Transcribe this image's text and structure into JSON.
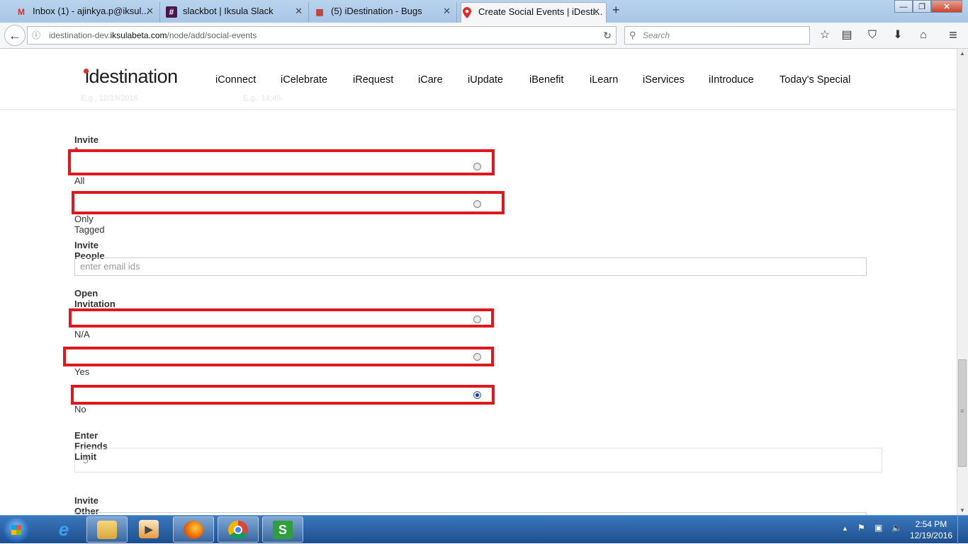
{
  "browser": {
    "tabs": [
      {
        "title": "Inbox (1) - ajinkya.p@iksul...",
        "icon": "gmail-icon",
        "icon_glyph": "M",
        "icon_color": "#d93025"
      },
      {
        "title": "slackbot | Iksula Slack",
        "icon": "slack-hash-icon",
        "icon_glyph": "#",
        "icon_color": "#4a154b"
      },
      {
        "title": "(5) iDestination - Bugs",
        "icon": "calendar-icon",
        "icon_glyph": "▦",
        "icon_color": "#c0392b"
      },
      {
        "title": "Create Social Events | iDesti...",
        "icon": "location-pin-icon",
        "icon_glyph": "⬤",
        "icon_color": "#e02b2b"
      }
    ],
    "tab_close_glyph": "✕",
    "new_tab_glyph": "+",
    "window_controls": {
      "minimize": "—",
      "maximize": "❐",
      "close": "✕"
    },
    "back_glyph": "←",
    "url_prefix": "idestination-dev.",
    "url_domain": "iksulabeta.com",
    "url_path": "/node/add/social-events",
    "search_placeholder": "Search",
    "toolbar_icons": [
      "bookmark-star-icon",
      "reading-list-icon",
      "pocket-icon",
      "download-icon",
      "home-icon",
      "menu-icon"
    ],
    "toolbar_glyphs": [
      "☆",
      "▤",
      "⛉",
      "⬇",
      "⌂",
      "≡"
    ]
  },
  "site": {
    "logo": "idestination",
    "nav": [
      "iConnect",
      "iCelebrate",
      "iRequest",
      "iCare",
      "iUpdate",
      "iBenefit",
      "iLearn",
      "iServices",
      "iIntroduce",
      "Today's Special"
    ],
    "ghost_left": "E.g., 12/19/2016",
    "ghost_right": "E.g., 14:45"
  },
  "form": {
    "invite_label": "Invite",
    "required_mark": "*",
    "invite_options": [
      {
        "label": "All",
        "checked": false
      },
      {
        "label": "Only Tagged",
        "checked": false
      }
    ],
    "invite_people_label": "Invite People",
    "invite_people_placeholder": "enter email ids",
    "open_invitation_label": "Open Invitation",
    "open_invitation_options": [
      {
        "label": "N/A",
        "checked": false
      },
      {
        "label": "Yes",
        "checked": false
      },
      {
        "label": "No",
        "checked": true
      }
    ],
    "friends_limit_label": "Enter Friends Limit",
    "friends_limit_value": "5",
    "invite_other_label": "Invite Other Peoples"
  },
  "highlight_color": "#e0171d",
  "taskbar": {
    "apps": [
      "file-explorer-icon",
      "media-player-icon",
      "firefox-icon",
      "chrome-icon",
      "s-app-icon"
    ],
    "time": "2:54 PM",
    "date": "12/19/2016"
  }
}
